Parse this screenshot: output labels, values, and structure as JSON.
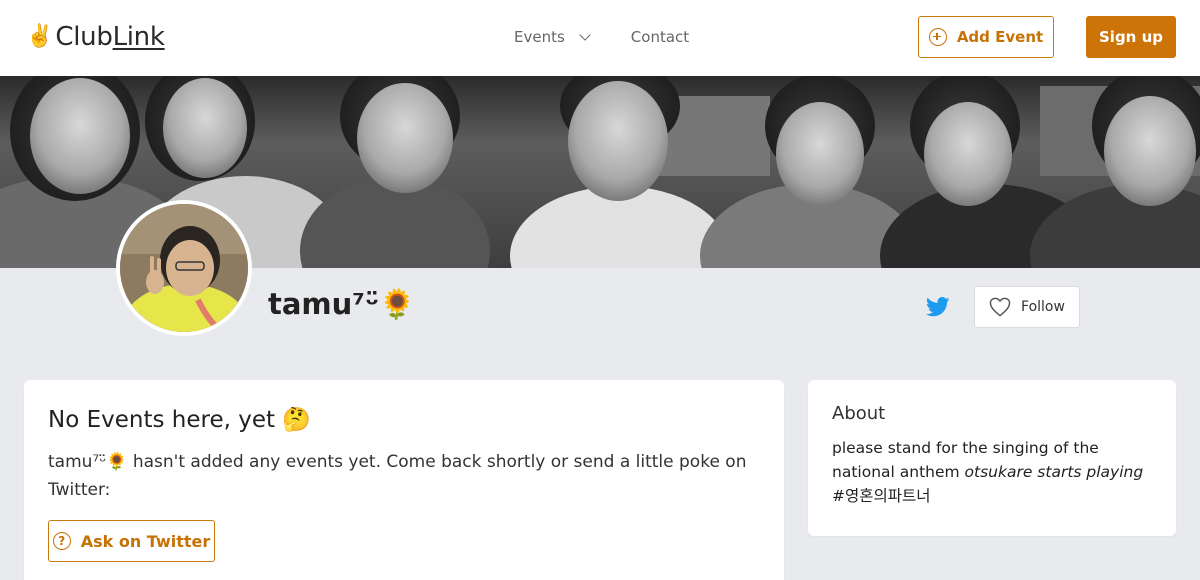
{
  "header": {
    "logo_emoji": "✌️",
    "logo_text_a": "Club",
    "logo_text_b": "Link",
    "nav": {
      "events_label": "Events",
      "contact_label": "Contact"
    },
    "add_event_label": "Add Event",
    "signup_label": "Sign up"
  },
  "profile": {
    "name": "tamu⁷ᵕ̈🌻",
    "follow_label": "Follow"
  },
  "events_card": {
    "title": "No Events here, yet 🤔",
    "body": "tamu⁷ᵕ̈🌻 hasn't added any events yet. Come back shortly or send a little poke on Twitter:",
    "ask_label": "Ask on Twitter"
  },
  "about_card": {
    "title": "About",
    "text_a": "please stand for the singing of the national anthem ",
    "text_italic": "otsukare starts playing",
    "text_b": " #영혼의파트너"
  },
  "colors": {
    "accent": "#cc7407",
    "twitter": "#1d9bf0",
    "page_bg": "#e9eaee"
  },
  "icons": {
    "nav_events": "chevron-down-icon",
    "add_event": "plus-circle-icon",
    "twitter": "twitter-icon",
    "follow": "heart-icon",
    "ask": "question-circle-icon"
  }
}
